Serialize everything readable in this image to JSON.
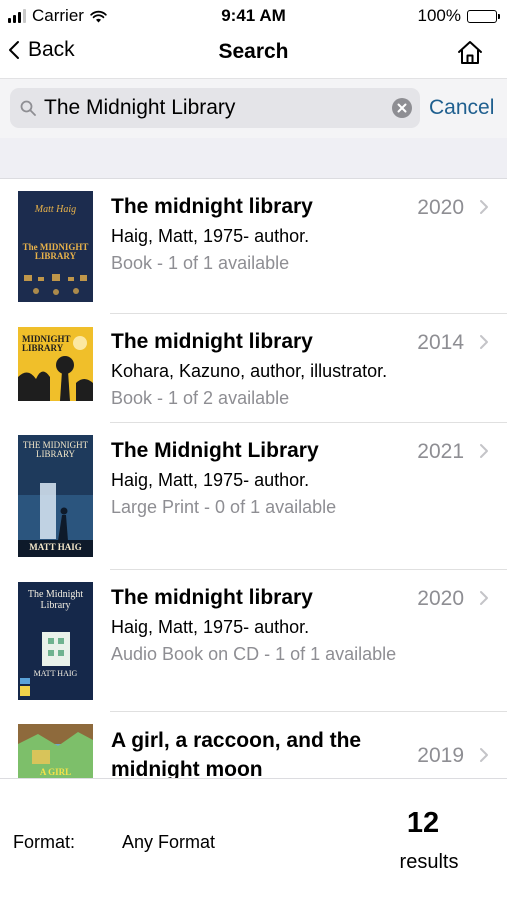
{
  "status_bar": {
    "carrier": "Carrier",
    "time": "9:41 AM",
    "battery": "100%"
  },
  "nav": {
    "back_label": "Back",
    "title": "Search"
  },
  "search": {
    "value": "The Midnight Library",
    "cancel_label": "Cancel"
  },
  "results": [
    {
      "title": "The midnight library",
      "year": "2020",
      "author": "Haig, Matt, 1975- author.",
      "status": "Book - 1 of 1 available",
      "cover": {
        "author": "Matt Haig",
        "title": "The MIDNIGHT LIBRARY",
        "bg": "#1c2c4e",
        "fg": "#e8b24a"
      }
    },
    {
      "title": "The midnight library",
      "year": "2014",
      "author": "Kohara, Kazuno, author, illustrator.",
      "status": "Book - 1 of 2 available",
      "cover": {
        "author": "",
        "title": "MIDNIGHT LIBRARY",
        "bg": "#f0bf2a",
        "fg": "#1e1e1e"
      }
    },
    {
      "title": "The Midnight Library",
      "year": "2021",
      "author": "Haig, Matt, 1975- author.",
      "status": "Large Print - 0 of 1 available",
      "cover": {
        "author": "MATT HAIG",
        "title": "THE MIDNIGHT LIBRARY",
        "bg": "#1e3a5c",
        "fg": "#f2e6c8"
      }
    },
    {
      "title": "The midnight library",
      "year": "2020",
      "author": "Haig, Matt, 1975- author.",
      "status": "Audio Book on CD - 1 of 1 available",
      "cover": {
        "author": "MATT HAIG",
        "title": "The Midnight Library",
        "bg": "#15284a",
        "fg": "#f4efe2"
      }
    },
    {
      "title": "A girl, a raccoon, and the midnight moon",
      "year": "2019",
      "author": "",
      "status": "",
      "cover": {
        "author": "",
        "title": "A GIRL",
        "bg": "#6fa8c8",
        "fg": "#f3e24a"
      }
    }
  ],
  "footer": {
    "format_label": "Format:",
    "format_value": "Any Format",
    "count": "12",
    "results_label": "results"
  }
}
